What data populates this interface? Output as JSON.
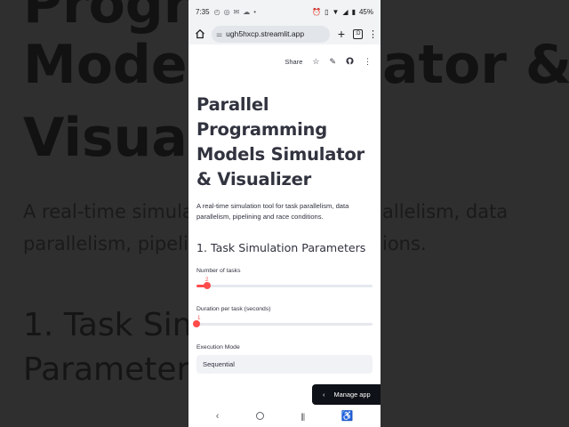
{
  "background": {
    "title_lines": [
      "Progra",
      "Model",
      "Visual"
    ],
    "desc_lines": [
      "A real-time simula",
      "parallelism, pipeli"
    ],
    "section_lines": [
      "1. Task Sim",
      "Parameter"
    ],
    "right_desc_lines": [
      "allelism, data",
      "ions."
    ],
    "right_title": "ator &"
  },
  "status_bar": {
    "time": "7:35",
    "battery": "45%"
  },
  "browser": {
    "url": "ugh5hxcp.streamlit.app",
    "tab_count": ":D"
  },
  "toolbar": {
    "share_label": "Share"
  },
  "page": {
    "title": "Parallel Programming Models Simulator & Visualizer",
    "description": "A real-time simulation tool for task parallelism, data parallelism, pipelining and race conditions.",
    "section_title": "1. Task Simulation Parameters",
    "slider_tasks": {
      "label": "Number of tasks",
      "value": "2",
      "fraction": 0.06
    },
    "slider_duration": {
      "label": "Duration per task (seconds)",
      "value": "1",
      "fraction": 0.0
    },
    "execution_mode": {
      "label": "Execution Mode",
      "selected": "Sequential"
    }
  },
  "manage_app": {
    "label": "Manage app"
  },
  "colors": {
    "accent": "#ff4b4b",
    "text": "#31333f",
    "input_bg": "#f0f2f6",
    "manage_bg": "#0e1117"
  },
  "icons": [
    "home-icon",
    "tune-icon",
    "plus-icon",
    "tabs-icon",
    "menu-icon",
    "star-icon",
    "edit-icon",
    "github-icon",
    "more-icon",
    "chevron-left-icon",
    "chevron-down-icon",
    "back-icon",
    "home-nav-icon",
    "recents-icon",
    "accessibility-icon"
  ]
}
